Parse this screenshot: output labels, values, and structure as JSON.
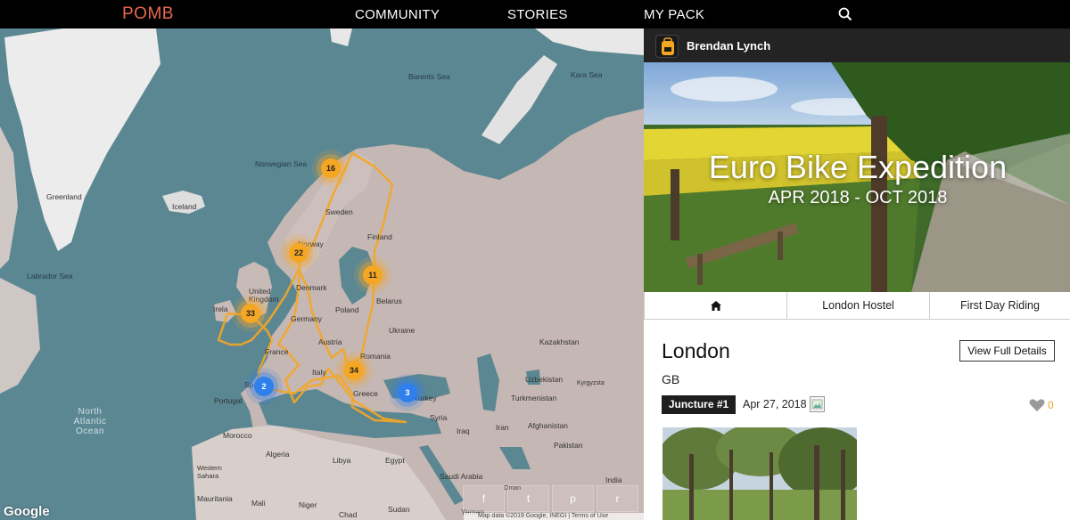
{
  "nav": {
    "brand": "POMB",
    "links": [
      "COMMUNITY",
      "STORIES",
      "MY PACK"
    ],
    "search_icon": "search-icon"
  },
  "map": {
    "labels": {
      "barents_sea": "Barents Sea",
      "kara_sea": "Kara Sea",
      "norwegian_sea": "Norwegian Sea",
      "greenland": "Greenland",
      "iceland": "Iceland",
      "labrador_sea": "Labrador Sea",
      "sweden": "Sweden",
      "finland": "Finland",
      "norway": "Norway",
      "denmark": "Denmark",
      "united_kingdom": "United Kingdom",
      "ireland": "Irela",
      "belarus": "Belarus",
      "poland": "Poland",
      "germany": "Germany",
      "ukraine": "Ukraine",
      "kazakhstan": "Kazakhstan",
      "france": "France",
      "austria": "Austria",
      "romania": "Romania",
      "italy": "Italy",
      "spain": "Sp",
      "portugal": "Portugal",
      "greece": "Greece",
      "turkey": "Turkey",
      "uzbekistan": "Uzbekistan",
      "kyrgyzstan": "Kyrgyzsta",
      "turkmenistan": "Turkmenistan",
      "syria": "Syria",
      "iraq": "Iraq",
      "iran": "Iran",
      "afghanistan": "Afghanistan",
      "pakistan": "Pakistan",
      "morocco": "Morocco",
      "algeria": "Algeria",
      "libya": "Libya",
      "egypt": "Egypt",
      "saudi_arabia": "Saudi Arabia",
      "oman": "Oman",
      "india": "India",
      "western_sahara": "Western Sahara",
      "mauritania": "Mauritania",
      "mali": "Mali",
      "niger": "Niger",
      "chad": "Chad",
      "sudan": "Sudan",
      "yemen": "Yemen",
      "ocean": "North Atlantic Ocean"
    },
    "clusters": [
      {
        "count": "16",
        "color": "orange"
      },
      {
        "count": "22",
        "color": "orange"
      },
      {
        "count": "11",
        "color": "orange"
      },
      {
        "count": "33",
        "color": "orange"
      },
      {
        "count": "34",
        "color": "orange"
      },
      {
        "count": "2",
        "color": "blue"
      },
      {
        "count": "3",
        "color": "blue"
      }
    ],
    "route_color": "#f5a623",
    "google_logo": "Google",
    "attribution": "Map data ©2019 Google, INEGI  |  Terms of Use",
    "share": [
      "f",
      "t",
      "p",
      "r"
    ]
  },
  "panel": {
    "user_name": "Brendan Lynch",
    "hero_title": "Euro Bike Expedition",
    "hero_dates": "APR 2018 - OCT 2018",
    "tabs": [
      "home-icon",
      "London Hostel",
      "First Day Riding"
    ],
    "place_name": "London",
    "country": "GB",
    "view_button": "View Full Details",
    "juncture_badge": "Juncture #1",
    "juncture_date": "Apr 27, 2018",
    "like_count": "0",
    "accent": "#f5a623"
  }
}
